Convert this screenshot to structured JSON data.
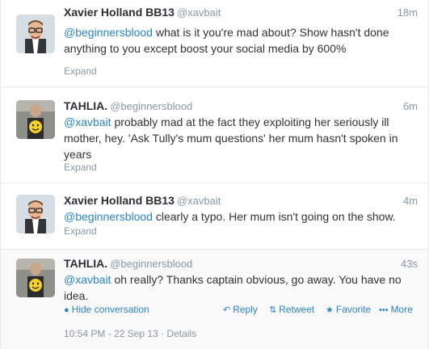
{
  "tweets": [
    {
      "fullname": "Xavier Holland BB13",
      "username": "@xavbait",
      "time": "18m",
      "mention": "@beginnersblood",
      "text": " what is it you're mad about? Show hasn't done anything to you except boost your social media by 600%",
      "expand": "Expand"
    },
    {
      "fullname": "TAHLIA.",
      "username": "@beginnersblood",
      "time": "6m",
      "mention": "@xavbait",
      "text": " probably mad at the fact they exploiting her seriously ill mother, hey. 'Ask Tully's mum questions' her mum hasn't spoken in years",
      "expand": "Expand"
    },
    {
      "fullname": "Xavier Holland BB13",
      "username": "@xavbait",
      "time": "4m",
      "mention": "@beginnersblood",
      "text": " clearly a typo. Her mum isn't going on the show.",
      "expand": "Expand"
    },
    {
      "fullname": "TAHLIA.",
      "username": "@beginnersblood",
      "time": "43s",
      "mention": "@xavbait",
      "text": " oh really? Thanks captain obvious, go away. You have no idea.",
      "hide_conversation": "Hide conversation",
      "reply": "Reply",
      "retweet": "Retweet",
      "favorite": "Favorite",
      "more": "More",
      "timestamp": "10:54 PM - 22 Sep 13",
      "details": "Details"
    }
  ],
  "colors": {
    "link": "#2a85c7",
    "muted": "#8899a6",
    "name": "#292f33"
  },
  "icons": {
    "hide_conversation": "speech-bubble-icon",
    "reply": "reply-arrow-icon",
    "retweet": "retweet-icon",
    "favorite": "star-icon",
    "more": "more-dots-icon"
  }
}
